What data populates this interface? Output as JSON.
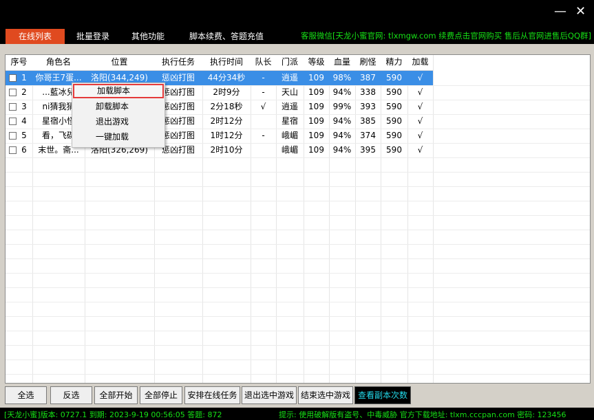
{
  "window": {
    "minimize": "—",
    "close": "✕"
  },
  "tabs": [
    {
      "label": "在线列表",
      "active": true
    },
    {
      "label": "批量登录",
      "active": false
    },
    {
      "label": "其他功能",
      "active": false
    },
    {
      "label": "脚本续费、答题充值",
      "active": false
    }
  ],
  "notice": "客服微信[天龙小蜜官网: tlxmgw.com 续费点击官网购买 售后从官网进售后QQ群]",
  "table": {
    "columns": [
      "序号",
      "角色名",
      "位置",
      "执行任务",
      "执行时间",
      "队长",
      "门派",
      "等级",
      "血量",
      "刷怪",
      "精力",
      "加载"
    ],
    "rows": [
      {
        "id": "1",
        "name": "你哥王7蛋...",
        "location": "洛阳(344,249)",
        "task": "惩凶打图",
        "time": "44分34秒",
        "leader": "-",
        "sect": "逍遥",
        "level": "109",
        "hp": "98%",
        "kills": "387",
        "energy": "590",
        "loaded": "√",
        "selected": true
      },
      {
        "id": "2",
        "name": "...藍冰兒",
        "location": "",
        "task": "惩凶打图",
        "time": "2时9分",
        "leader": "-",
        "sect": "天山",
        "level": "109",
        "hp": "94%",
        "kills": "338",
        "energy": "590",
        "loaded": "√",
        "selected": false
      },
      {
        "id": "3",
        "name": "ni猜我猜",
        "location": "",
        "task": "惩凶打图",
        "time": "2分18秒",
        "leader": "√",
        "sect": "逍遥",
        "level": "109",
        "hp": "99%",
        "kills": "393",
        "energy": "590",
        "loaded": "√",
        "selected": false
      },
      {
        "id": "4",
        "name": "星宿小怪",
        "location": "",
        "task": "惩凶打图",
        "time": "2时12分",
        "leader": "",
        "sect": "星宿",
        "level": "109",
        "hp": "94%",
        "kills": "385",
        "energy": "590",
        "loaded": "√",
        "selected": false
      },
      {
        "id": "5",
        "name": "看，飞碟",
        "location": "",
        "task": "惩凶打图",
        "time": "1时12分",
        "leader": "-",
        "sect": "峨嵋",
        "level": "109",
        "hp": "94%",
        "kills": "374",
        "energy": "590",
        "loaded": "√",
        "selected": false
      },
      {
        "id": "6",
        "name": "末世。斋...",
        "location": "洛阳(326,269)",
        "task": "惩凶打图",
        "time": "2时10分",
        "leader": "",
        "sect": "峨嵋",
        "level": "109",
        "hp": "94%",
        "kills": "395",
        "energy": "590",
        "loaded": "√",
        "selected": false
      }
    ]
  },
  "context_menu": [
    "加载脚本",
    "卸载脚本",
    "退出游戏",
    "一键加载"
  ],
  "buttons": [
    "全选",
    "反选",
    "全部开始",
    "全部停止",
    "安排在线任务",
    "退出选中游戏",
    "结束选中游戏",
    "查看副本次数"
  ],
  "status": {
    "left": "[天龙小蜜]版本: 0727.1  到期: 2023-9-19 00:56:05  答题: 872",
    "right": "提示: 使用破解版有盗号、中毒威胁 官方下载地址: tlxm.cccpan.com 密码: 123456"
  },
  "colors": {
    "accent": "#e04a1f",
    "notice_green": "#16e016",
    "selection": "#3a8ee6",
    "highlight_box": "#e53a3a",
    "cyan_button_text": "#22d8e8"
  }
}
